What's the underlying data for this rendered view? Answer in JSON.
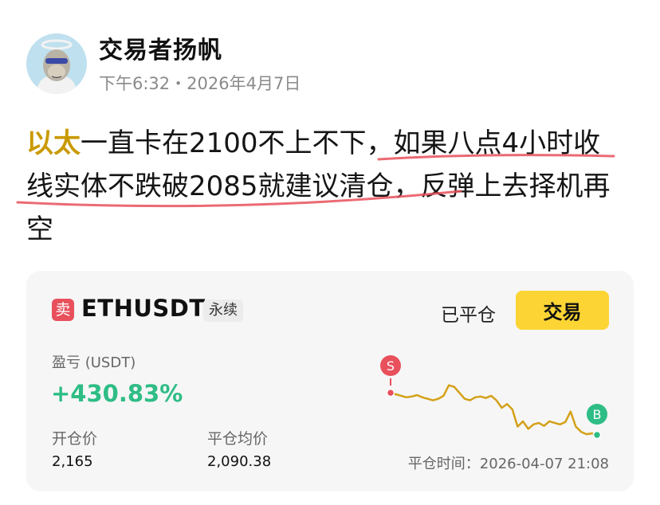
{
  "author": {
    "name": "交易者扬帆",
    "meta": "下午6:32・2026年4月7日"
  },
  "post": {
    "tag": "以太",
    "line1_rest": "一直卡在2100不上不下，如果八点4小时收",
    "line2": "线实体不跌破2085就建议清仓，反弹上去择机再",
    "line3": "空"
  },
  "colors": {
    "accent": "#c99a00",
    "underline": "#e8505b",
    "profit": "#2ebd85",
    "sell": "#e8505b",
    "chart_line": "#d4a017",
    "trade_button": "#fcd535"
  },
  "card": {
    "side": "卖",
    "pair": "ETHUSDT",
    "contract_type": "永续",
    "status": "已平仓",
    "trade_button": "交易",
    "pnl_label": "盈亏 (USDT)",
    "pnl_value": "+430.83%",
    "open_price_label": "开仓价",
    "open_price": "2,165",
    "close_price_label": "平仓均价",
    "close_price": "2,090.38",
    "close_time_label": "平仓时间：",
    "close_time": "2026-04-07 21:08"
  },
  "chart": {
    "sell_marker": "S",
    "buy_marker": "B",
    "series": [
      60,
      58,
      56,
      54,
      55,
      57,
      54,
      52,
      50,
      52,
      56,
      70,
      68,
      60,
      52,
      50,
      54,
      55,
      53,
      56,
      50,
      40,
      45,
      38,
      15,
      22,
      12,
      18,
      20,
      16,
      22,
      20,
      18,
      21,
      35,
      15,
      8,
      5,
      6,
      4
    ]
  }
}
